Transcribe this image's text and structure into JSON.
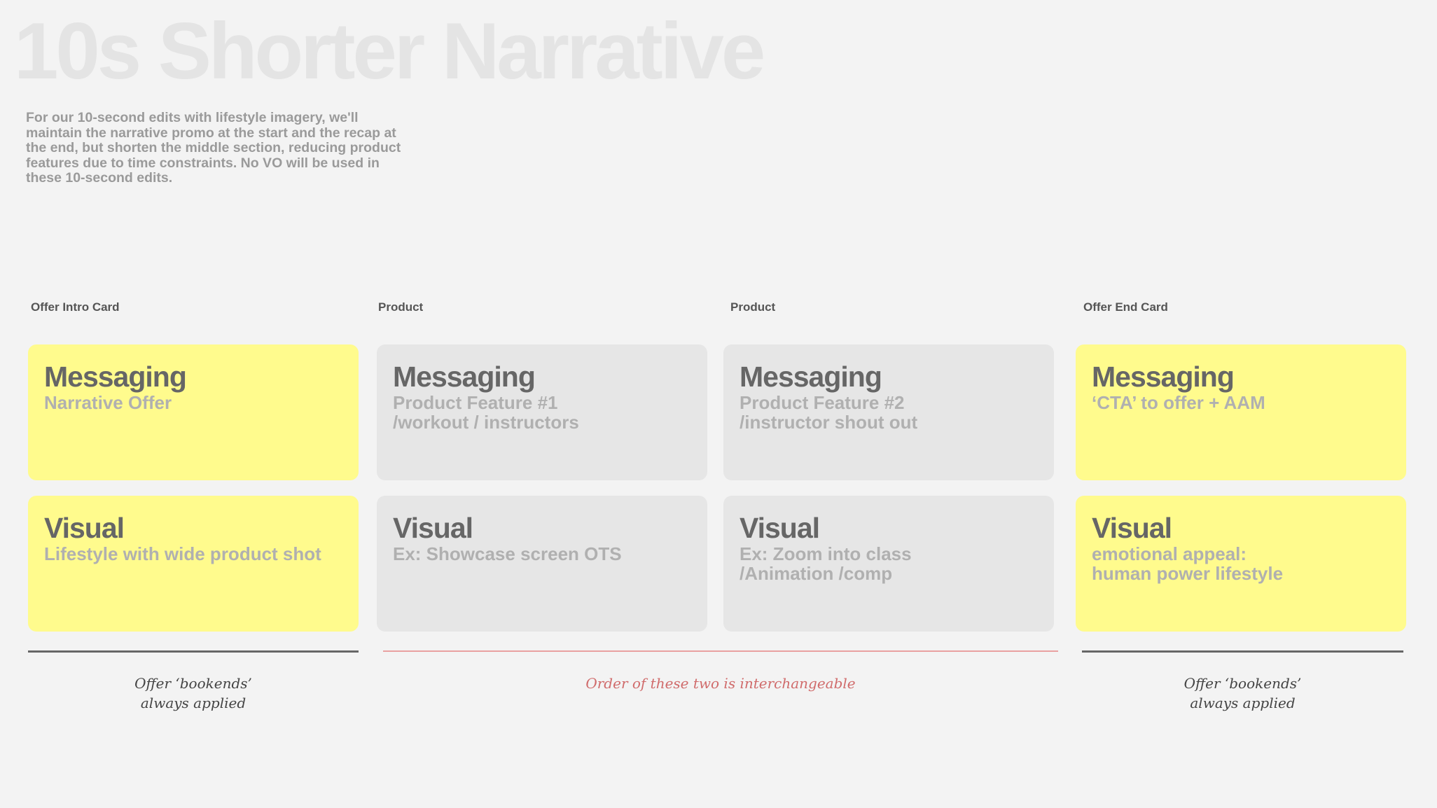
{
  "title": "10s Shorter Narrative",
  "intro": "For our 10-second edits with lifestyle imagery, we'll maintain the narrative promo at the start and the recap at the end, but shorten the middle section, reducing product features due to time constraints. No VO will be used in these 10-second edits.",
  "columns": [
    {
      "label": "Offer Intro Card",
      "messaging": {
        "heading": "Messaging",
        "text": "Narrative Offer"
      },
      "visual": {
        "heading": "Visual",
        "text": "Lifestyle with wide product shot"
      }
    },
    {
      "label": "Product",
      "messaging": {
        "heading": "Messaging",
        "text": "Product Feature #1\n/workout / instructors"
      },
      "visual": {
        "heading": "Visual",
        "text": "Ex: Showcase screen OTS"
      }
    },
    {
      "label": "Product",
      "messaging": {
        "heading": "Messaging",
        "text": "Product Feature #2\n/instructor shout out"
      },
      "visual": {
        "heading": "Visual",
        "text": "Ex: Zoom into class\n/Animation /comp"
      }
    },
    {
      "label": "Offer End Card",
      "messaging": {
        "heading": "Messaging",
        "text": "‘CTA’ to offer + AAM"
      },
      "visual": {
        "heading": "Visual",
        "text": "emotional appeal:\nhuman power lifestyle"
      }
    }
  ],
  "notes": {
    "left": "Offer ‘bookends’\nalways applied",
    "middle": "Order of these two is interchangeable",
    "right": "Offer ‘bookends’\nalways applied"
  },
  "colors": {
    "background": "#f3f3f3",
    "bookend_card": "#fffb8d",
    "product_card": "#e6e6e6",
    "interchangeable_accent": "#d06b6b"
  }
}
